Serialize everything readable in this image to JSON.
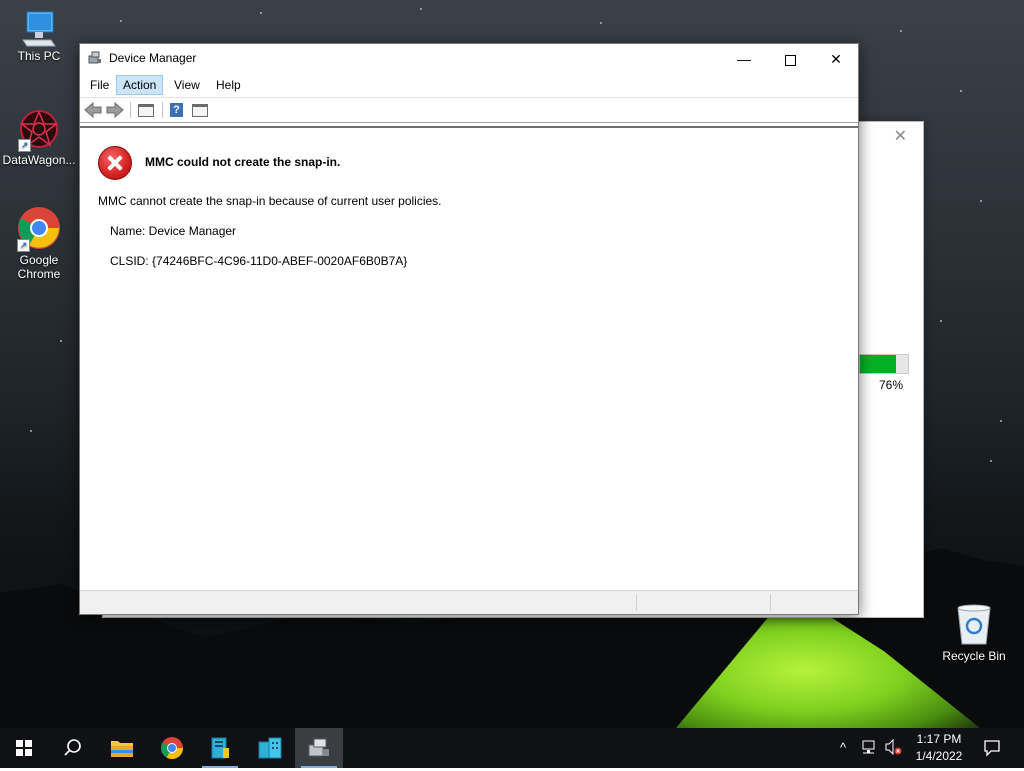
{
  "desktop": {
    "icons": [
      {
        "label": "This PC"
      },
      {
        "label": "DataWagon..."
      },
      {
        "label": "Google\nChrome"
      },
      {
        "label": "Recycle Bin"
      }
    ]
  },
  "background_window": {
    "close_glyph": "✕",
    "progress_fraction": 0.76,
    "progress_text": "76%"
  },
  "window": {
    "title": "Device Manager",
    "minimize_glyph": "—",
    "close_glyph": "✕",
    "menu": [
      "File",
      "Action",
      "View",
      "Help"
    ],
    "active_menu": "Action",
    "toolbar": {
      "back_icon": "back-arrow-icon",
      "forward_icon": "forward-arrow-icon",
      "help_glyph": "?"
    }
  },
  "error": {
    "title": "MMC could not create the snap-in.",
    "message": "MMC cannot create the snap-in because of current user policies.",
    "name_line": "Name: Device Manager",
    "clsid_line": "CLSID: {74246BFC-4C96-11D0-ABEF-0020AF6B0B7A}"
  },
  "taskbar": {
    "clock_time": "1:17 PM",
    "clock_date": "1/4/2022",
    "apps": [
      "start",
      "search",
      "file-explorer",
      "chrome",
      "server-app",
      "datawagon",
      "device-manager"
    ],
    "active_app": "device-manager"
  },
  "colors": {
    "menu_highlight": "#cce4f7",
    "error_red": "#d42020",
    "taskbar": "#101114",
    "tent_green": "#7fd11f"
  }
}
